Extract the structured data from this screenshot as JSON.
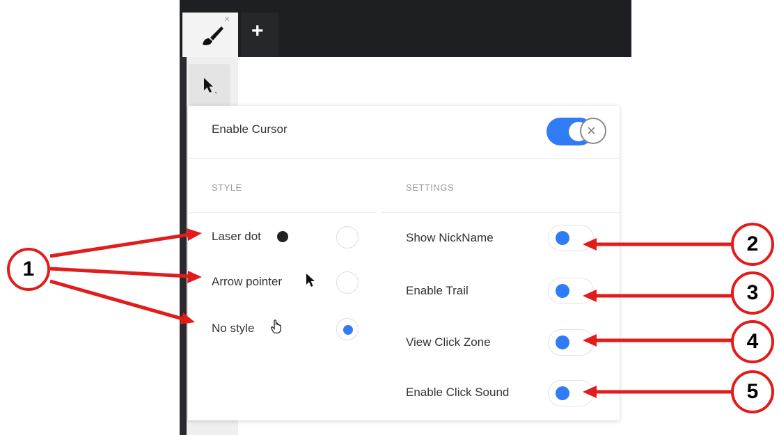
{
  "tabs": {
    "active_icon": "paint-brush-icon",
    "close_symbol": "×",
    "add_symbol": "+"
  },
  "toolbar": {
    "selected_tool_icon": "cursor-arrow-icon"
  },
  "panel": {
    "enable_cursor_label": "Enable Cursor",
    "enable_cursor_on": true,
    "close_symbol": "×",
    "style_header": "STYLE",
    "settings_header": "SETTINGS",
    "style_options": [
      {
        "label": "Laser dot",
        "icon": "laser-dot-icon",
        "selected": false
      },
      {
        "label": "Arrow pointer",
        "icon": "arrow-pointer-icon",
        "selected": false
      },
      {
        "label": "No style",
        "icon": "hand-pointer-icon",
        "selected": true
      }
    ],
    "settings": [
      {
        "label": "Show NickName",
        "enabled": true
      },
      {
        "label": "Enable Trail",
        "enabled": true
      },
      {
        "label": "View Click Zone",
        "enabled": true
      },
      {
        "label": "Enable Click Sound",
        "enabled": true
      }
    ]
  },
  "annotations": [
    "1",
    "2",
    "3",
    "4",
    "5"
  ],
  "colors": {
    "accent": "#2f7cf6",
    "annotation": "#e21b1b",
    "chrome_dark": "#1e1f23"
  }
}
